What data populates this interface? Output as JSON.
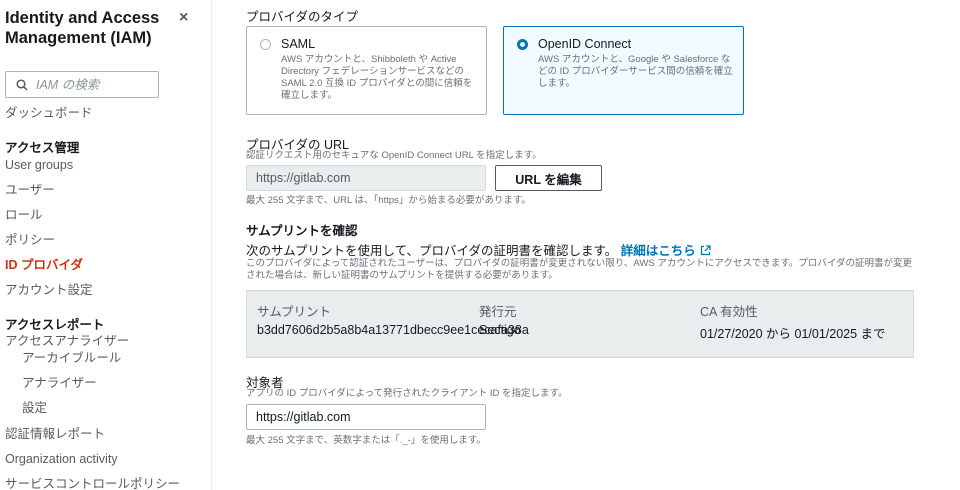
{
  "sidebar": {
    "title": "Identity and Access Management (IAM)",
    "close_icon": "×",
    "search_placeholder": "IAM の検索",
    "dashboard": "ダッシュボード",
    "access_mgmt_header": "アクセス管理",
    "user_groups": "User groups",
    "users": "ユーザー",
    "roles": "ロール",
    "policies": "ポリシー",
    "identity_providers": "ID プロバイダ",
    "account_settings": "アカウント設定",
    "access_reports_header": "アクセスレポート",
    "access_analyzer": "アクセスアナライザー",
    "archive_rules": "アーカイブルール",
    "analyzers": "アナライザー",
    "settings": "設定",
    "credential_report": "認証情報レポート",
    "org_activity": "Organization activity",
    "scp": "サービスコントロールポリシー"
  },
  "provider_type": {
    "label": "プロバイダのタイプ",
    "saml": {
      "title": "SAML",
      "desc": "AWS アカウントと、Shibboleth や Active Directory フェデレーションサービスなどの SAML 2.0 互換 ID プロバイダとの間に信頼を確立します。",
      "selected": false
    },
    "oidc": {
      "title": "OpenID Connect",
      "desc": "AWS アカウントと、Google や Salesforce などの ID プロバイダーサービス間の信頼を確立します。",
      "selected": true
    }
  },
  "provider_url": {
    "label": "プロバイダの URL",
    "desc": "認証リクエスト用のセキュアな OpenID Connect URL を指定します。",
    "value": "https://gitlab.com",
    "edit_button": "URL を編集",
    "hint": "最大 255 文字まで、URL は、「https」から始まる必要があります。"
  },
  "thumbprint": {
    "header": "サムプリントを確認",
    "intro": "次のサムプリントを使用して、プロバイダの証明書を確認します。",
    "link": "詳細はこちら",
    "desc": "このプロバイダによって認証されたユーザーは、プロバイダの証明書が変更されない限り、AWS アカウントにアクセスできます。プロバイダの証明書が変更された場合は、新しい証明書のサムプリントを提供する必要があります。",
    "col_thumbprint": "サムプリント",
    "col_issuer": "発行元",
    "col_ca": "CA 有効性",
    "thumbprint_value": "b3dd7606d2b5a8b4a13771dbecc9ee1cecafa38a",
    "issuer_value": "Sectigo",
    "ca_value": "01/27/2020 から 01/01/2025 まで"
  },
  "audience": {
    "label": "対象者",
    "desc": "アプリの ID プロバイダによって発行されたクライアント ID を指定します。",
    "value": "https://gitlab.com",
    "hint": "最大 255 文字まで、英数字または「._-」を使用します。"
  }
}
